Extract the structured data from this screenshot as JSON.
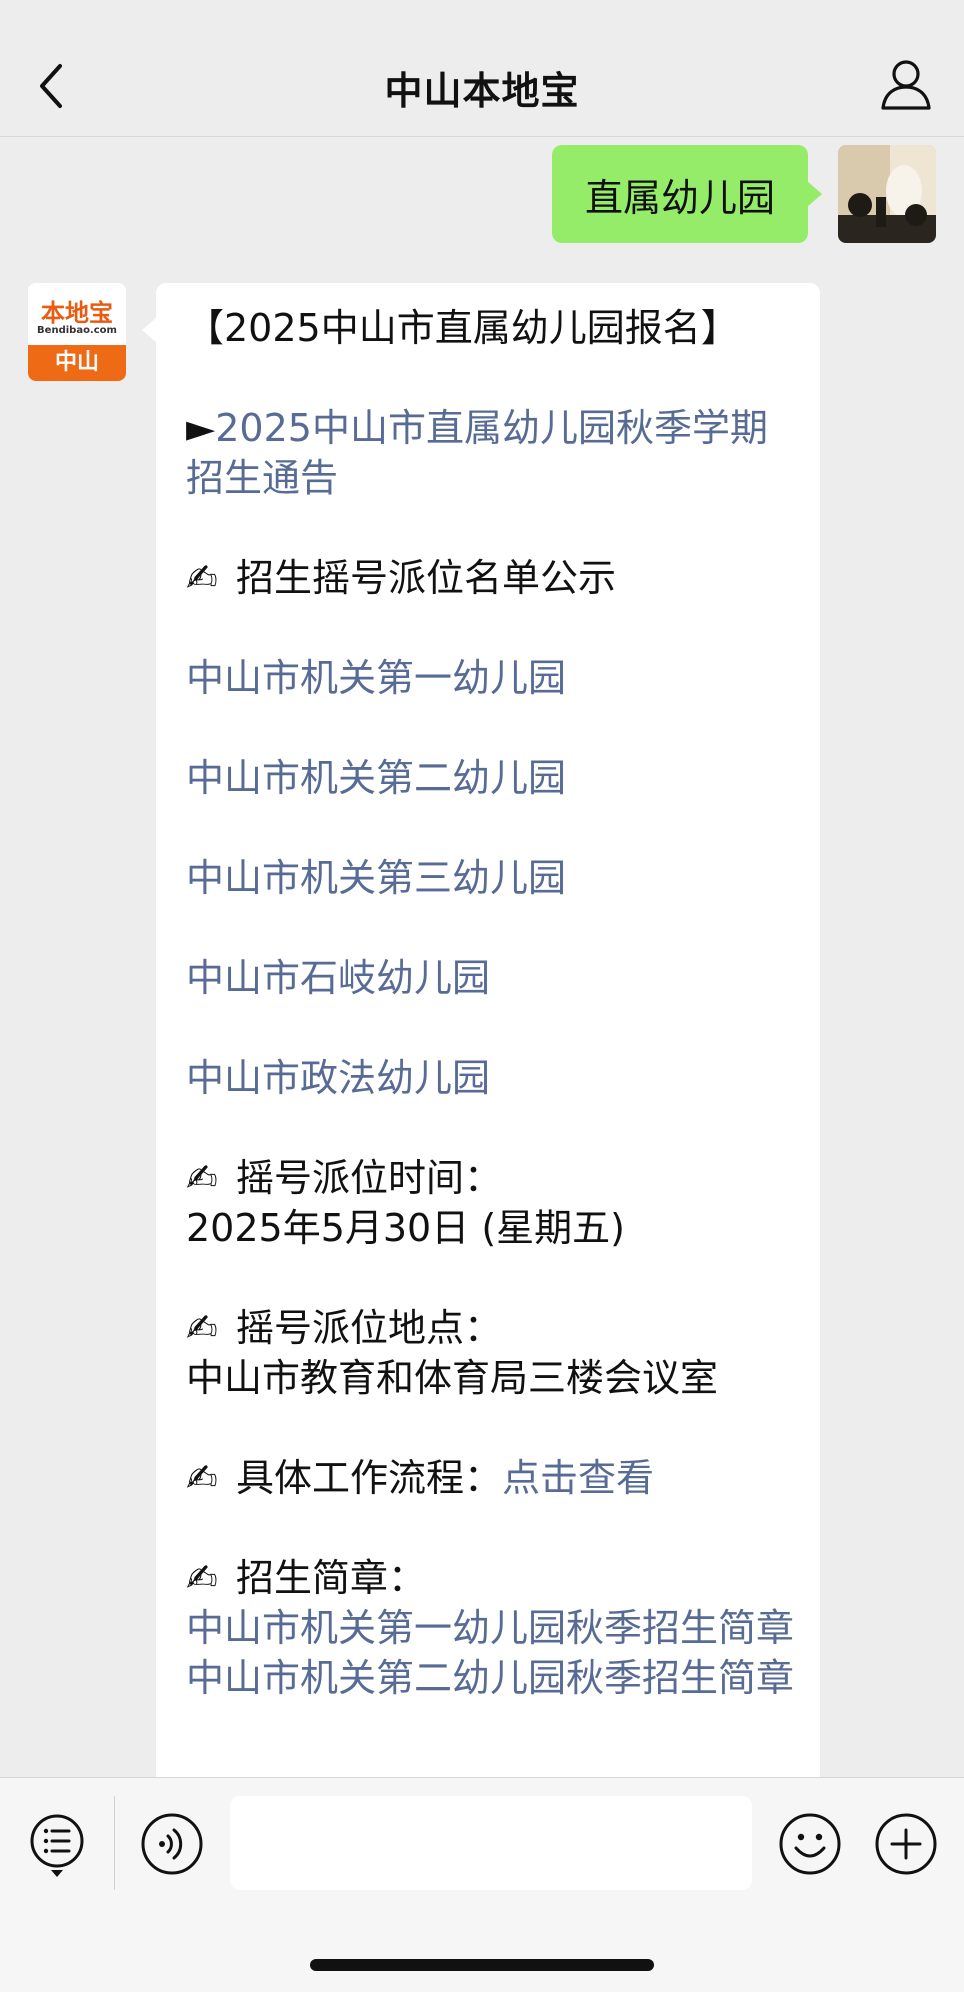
{
  "header": {
    "title": "中山本地宝"
  },
  "me": {
    "message": "直属幼儿园"
  },
  "bot": {
    "avatar_brand": "本地宝",
    "avatar_domain": "Bendibao.com",
    "avatar_city": "中山",
    "headline": "【2025中山市直属幼儿园报名】",
    "notice_marker": "►",
    "notice_link": "2025中山市直属幼儿园秋季学期招生通告",
    "emoji": "✍",
    "list_title": "招生摇号派位名单公示",
    "schools": [
      "中山市机关第一幼儿园",
      "中山市机关第二幼儿园",
      "中山市机关第三幼儿园",
      "中山市石岐幼儿园",
      "中山市政法幼儿园"
    ],
    "time_label": "摇号派位时间：",
    "time_value": "2025年5月30日 (星期五)",
    "place_label": "摇号派位地点：",
    "place_value": "中山市教育和体育局三楼会议室",
    "process_label": "具体工作流程：",
    "process_link": "点击查看",
    "brochure_label": "招生简章：",
    "brochures": [
      "中山市机关第一幼儿园秋季招生简章",
      "中山市机关第二幼儿园秋季招生简章"
    ]
  },
  "toolbar": {
    "input_value": ""
  }
}
